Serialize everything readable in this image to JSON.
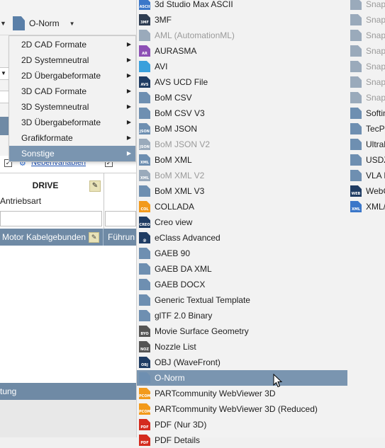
{
  "toolbar": {
    "format_button_label": "O-Norm"
  },
  "category_menu": {
    "items": [
      {
        "label": "2D CAD Formate",
        "active": false
      },
      {
        "label": "2D Systemneutral",
        "active": false
      },
      {
        "label": "2D Übergabeformate",
        "active": false
      },
      {
        "label": "3D CAD Formate",
        "active": false
      },
      {
        "label": "3D Systemneutral",
        "active": false
      },
      {
        "label": "3D Übergabeformate",
        "active": false
      },
      {
        "label": "Grafikformate",
        "active": false
      },
      {
        "label": "Sonstige",
        "active": true
      }
    ]
  },
  "background": {
    "nebenvariablen_link": "Nebenvariablen",
    "drive_title": "DRIVE",
    "antriebsart_label": "Antriebsart",
    "grid_col1": "Motor Kabelgebunden",
    "grid_col2": "Führun",
    "bottom_bar_text": "tung"
  },
  "formats_col1": [
    {
      "label": "3d Studio Max ASCII",
      "icon": "ascii-doc-icon",
      "color": "#3b77c9",
      "tag": "ASCII",
      "state": "normal"
    },
    {
      "label": "3MF",
      "icon": "3mf-doc-icon",
      "color": "#2e3d52",
      "tag": "3MF",
      "state": "normal"
    },
    {
      "label": "AML (AutomationML)",
      "icon": "aml-doc-icon",
      "color": "#9aaabb",
      "tag": "",
      "state": "disabled"
    },
    {
      "label": "AURASMA",
      "icon": "ar-doc-icon",
      "color": "#8d4fb5",
      "tag": "AR",
      "state": "normal"
    },
    {
      "label": "AVI",
      "icon": "avi-doc-icon",
      "color": "#3aa0dc",
      "tag": "",
      "state": "normal"
    },
    {
      "label": "AVS UCD File",
      "icon": "avs-doc-icon",
      "color": "#1f3c63",
      "tag": "AVS",
      "state": "normal"
    },
    {
      "label": "BoM CSV",
      "icon": "bom-csv-doc-icon",
      "color": "#6e8fb1",
      "tag": "",
      "state": "normal"
    },
    {
      "label": "BoM CSV V3",
      "icon": "bom-csv-v3-doc-icon",
      "color": "#6e8fb1",
      "tag": "",
      "state": "normal"
    },
    {
      "label": "BoM JSON",
      "icon": "json-doc-icon",
      "color": "#6e8fb1",
      "tag": "JSON",
      "state": "normal"
    },
    {
      "label": "BoM JSON V2",
      "icon": "json-v2-doc-icon",
      "color": "#9aaabb",
      "tag": "JSON",
      "state": "disabled"
    },
    {
      "label": "BoM XML",
      "icon": "xml-doc-icon",
      "color": "#6e8fb1",
      "tag": "XML",
      "state": "normal"
    },
    {
      "label": "BoM XML V2",
      "icon": "xml-v2-doc-icon",
      "color": "#9aaabb",
      "tag": "XML",
      "state": "disabled"
    },
    {
      "label": "BoM XML V3",
      "icon": "xml-v3-doc-icon",
      "color": "#6e8fb1",
      "tag": "",
      "state": "normal"
    },
    {
      "label": "COLLADA",
      "icon": "collada-doc-icon",
      "color": "#f29a1c",
      "tag": "COL",
      "state": "normal"
    },
    {
      "label": "Creo view",
      "icon": "creo-doc-icon",
      "color": "#1f3c63",
      "tag": "CREO",
      "state": "normal"
    },
    {
      "label": "eClass Advanced",
      "icon": "eclass-doc-icon",
      "color": "#1f3c63",
      "tag": "@",
      "state": "normal"
    },
    {
      "label": "GAEB 90",
      "icon": "gaeb90-doc-icon",
      "color": "#6e8fb1",
      "tag": "",
      "state": "normal"
    },
    {
      "label": "GAEB DA XML",
      "icon": "gaeb-xml-doc-icon",
      "color": "#6e8fb1",
      "tag": "",
      "state": "normal"
    },
    {
      "label": "GAEB DOCX",
      "icon": "gaeb-docx-doc-icon",
      "color": "#6e8fb1",
      "tag": "",
      "state": "normal"
    },
    {
      "label": "Generic Textual Template",
      "icon": "template-doc-icon",
      "color": "#6e8fb1",
      "tag": "",
      "state": "normal"
    },
    {
      "label": "glTF 2.0 Binary",
      "icon": "gltf-doc-icon",
      "color": "#6e8fb1",
      "tag": "",
      "state": "normal"
    },
    {
      "label": "Movie Surface Geometry",
      "icon": "msg-doc-icon",
      "color": "#555555",
      "tag": "BYO",
      "state": "normal"
    },
    {
      "label": "Nozzle List",
      "icon": "nozzle-doc-icon",
      "color": "#555555",
      "tag": "NOZ",
      "state": "normal"
    },
    {
      "label": "OBJ (WaveFront)",
      "icon": "obj-doc-icon",
      "color": "#1f3c63",
      "tag": "OBJ",
      "state": "normal"
    },
    {
      "label": "O-Norm",
      "icon": "onorm-doc-icon",
      "color": "#6e8fb1",
      "tag": "",
      "state": "selected"
    },
    {
      "label": "PARTcommunity WebViewer 3D",
      "icon": "webviewer-doc-icon",
      "color": "#f29a1c",
      "tag": "PCOM",
      "state": "normal"
    },
    {
      "label": "PARTcommunity WebViewer 3D (Reduced)",
      "icon": "webviewer-reduced-doc-icon",
      "color": "#f29a1c",
      "tag": "PCOM",
      "state": "normal"
    },
    {
      "label": "PDF (Nur 3D)",
      "icon": "pdf-doc-icon",
      "color": "#d42b1e",
      "tag": "PDF",
      "state": "normal"
    },
    {
      "label": "PDF Details",
      "icon": "pdf-details-doc-icon",
      "color": "#d42b1e",
      "tag": "PDF",
      "state": "normal"
    }
  ],
  "formats_col2": [
    {
      "label": "Snapl",
      "icon": "snap-doc-icon",
      "color": "#9aaabb",
      "tag": "",
      "state": "disabled"
    },
    {
      "label": "Snapl",
      "icon": "snap-doc-icon",
      "color": "#9aaabb",
      "tag": "",
      "state": "disabled"
    },
    {
      "label": "Snapl",
      "icon": "snap-doc-icon",
      "color": "#9aaabb",
      "tag": "",
      "state": "disabled"
    },
    {
      "label": "Snapl",
      "icon": "snap-doc-icon",
      "color": "#9aaabb",
      "tag": "",
      "state": "disabled"
    },
    {
      "label": "Snapl",
      "icon": "snap-doc-icon",
      "color": "#9aaabb",
      "tag": "",
      "state": "disabled"
    },
    {
      "label": "Snapl",
      "icon": "snap-doc-icon",
      "color": "#9aaabb",
      "tag": "",
      "state": "disabled"
    },
    {
      "label": "Snapl",
      "icon": "snap-doc-icon",
      "color": "#9aaabb",
      "tag": "",
      "state": "disabled"
    },
    {
      "label": "Softin",
      "icon": "softin-doc-icon",
      "color": "#6e8fb1",
      "tag": "",
      "state": "normal"
    },
    {
      "label": "TecPl",
      "icon": "tecpl-doc-icon",
      "color": "#6e8fb1",
      "tag": "",
      "state": "normal"
    },
    {
      "label": "Ultral",
      "icon": "ultral-doc-icon",
      "color": "#6e8fb1",
      "tag": "",
      "state": "normal"
    },
    {
      "label": "USDZ",
      "icon": "usdz-doc-icon",
      "color": "#6e8fb1",
      "tag": "",
      "state": "normal"
    },
    {
      "label": "VLA F",
      "icon": "vla-doc-icon",
      "color": "#6e8fb1",
      "tag": "",
      "state": "normal"
    },
    {
      "label": "WebG",
      "icon": "webg-doc-icon",
      "color": "#1f3c63",
      "tag": "WEB",
      "state": "normal"
    },
    {
      "label": "XML/",
      "icon": "xml-col2-doc-icon",
      "color": "#3b77c9",
      "tag": "XML",
      "state": "normal"
    }
  ]
}
